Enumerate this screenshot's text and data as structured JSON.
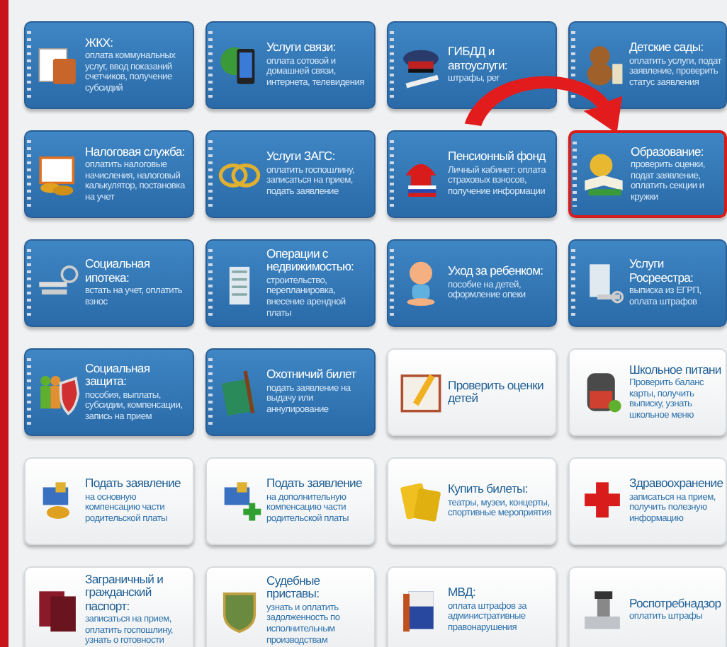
{
  "services": [
    {
      "kind": "blue",
      "title": "ЖКХ:",
      "description": "оплата коммунальных услуг, ввод показаний счетчиков, получение субсидий",
      "selected": false
    },
    {
      "kind": "blue",
      "title": "Услуги связи:",
      "description": "оплата сотовой и домашней связи, интернета, телевидения",
      "selected": false
    },
    {
      "kind": "blue",
      "title": "ГИБДД и автоуслуги:",
      "description": "штрафы, рег",
      "selected": false
    },
    {
      "kind": "blue",
      "title": "Детские сады:",
      "description": "оплатить услуги, подат заявление, проверить статус заявления",
      "selected": false
    },
    {
      "kind": "blue",
      "title": "Налоговая служба:",
      "description": "оплатить налоговые начисления, налоговый калькулятор, постановка на учет",
      "selected": false
    },
    {
      "kind": "blue",
      "title": "Услуги ЗАГС:",
      "description": "оплатить госпошлину, записаться на прием, подать заявление",
      "selected": false
    },
    {
      "kind": "blue",
      "title": "Пенсионный фонд",
      "description": "Личный кабинет: оплата страховых взносов, получение информации",
      "selected": false
    },
    {
      "kind": "blue",
      "title": "Образование:",
      "description": "проверить оценки, подат заявление, оплатить секции и кружки",
      "selected": true
    },
    {
      "kind": "blue",
      "title": "Социальная ипотека:",
      "description": "встать на учет, оплатить взнос",
      "selected": false
    },
    {
      "kind": "blue",
      "title": "Операции с недвижимостью:",
      "description": "строительство, перепланировка, внесение арендной платы",
      "selected": false
    },
    {
      "kind": "blue",
      "title": "Уход за ребенком:",
      "description": "пособие на детей, оформление опеки",
      "selected": false
    },
    {
      "kind": "blue",
      "title": "Услуги Росреестра:",
      "description": "выписка из ЕГРП, оплата штрафов",
      "selected": false
    },
    {
      "kind": "blue",
      "title": "Социальная защита:",
      "description": "пособия, выплаты, субсидии, компенсации, запись на прием",
      "selected": false
    },
    {
      "kind": "blue",
      "title": "Охотничий билет",
      "description": "подать заявление на выдачу или аннулирование",
      "selected": false
    },
    {
      "kind": "plain",
      "title": "Проверить оценки детей",
      "selected": false
    },
    {
      "kind": "plain",
      "title": "Школьное питани",
      "description": "Проверить баланс карты, получить выписку, узнать школьное меню",
      "selected": false
    },
    {
      "kind": "plain",
      "title": "Подать заявление",
      "description": "на основную компенсацию части родительской платы",
      "selected": false
    },
    {
      "kind": "plain",
      "title": "Подать заявление",
      "description": "на дополнительную компенсацию части родительской платы",
      "selected": false
    },
    {
      "kind": "plain",
      "title": "Купить билеты:",
      "description": "театры, музеи, концерты, спортивные мероприятия",
      "selected": false
    },
    {
      "kind": "plain",
      "title": "Здравоохранение",
      "description": "записаться на прием, получить полезную информацию",
      "selected": false
    },
    {
      "kind": "plain",
      "title": "Заграничный и гражданский паспорт:",
      "description": "записаться на прием, оплатить госпошлину, узнать о готовности",
      "selected": false
    },
    {
      "kind": "plain",
      "title": "Судебные приставы:",
      "description": "узнать и оплатить задолженность по исполнительным производствам",
      "selected": false
    },
    {
      "kind": "plain",
      "title": "МВД:",
      "description": "оплата штрафов за административные правонарушения",
      "selected": false
    },
    {
      "kind": "plain",
      "title": "Роспотребнадзор",
      "description": "оплатить штрафы",
      "selected": false
    }
  ]
}
